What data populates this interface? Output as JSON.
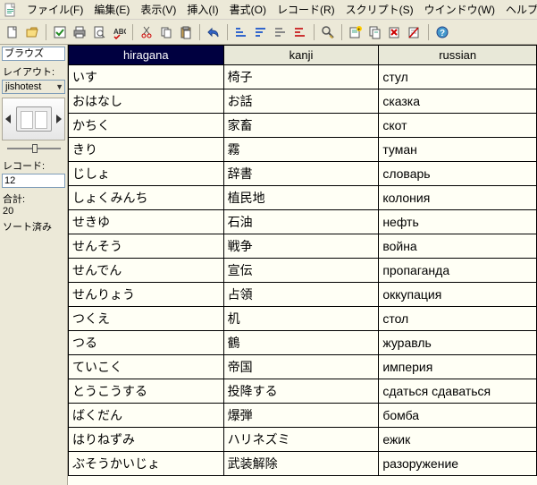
{
  "menu": {
    "file": "ファイル(F)",
    "edit": "編集(E)",
    "view": "表示(V)",
    "insert": "挿入(I)",
    "format": "書式(O)",
    "records": "レコード(R)",
    "scripts": "スクリプト(S)",
    "window": "ウインドウ(W)",
    "help": "ヘルプ(H)"
  },
  "sidebar": {
    "mode": "ブラウズ",
    "layout_label": "レイアウト:",
    "layout_value": "jishotest",
    "record_label": "レコード:",
    "record_value": "12",
    "total_label": "合計:",
    "total_value": "20",
    "sorted": "ソート済み"
  },
  "columns": {
    "c1": "hiragana",
    "c2": "kanji",
    "c3": "russian"
  },
  "rows": [
    {
      "h": "いす",
      "k": "椅子",
      "r": "стул"
    },
    {
      "h": "おはなし",
      "k": "お話",
      "r": "сказка"
    },
    {
      "h": "かちく",
      "k": "家畜",
      "r": "скот"
    },
    {
      "h": "きり",
      "k": "霧",
      "r": "туман"
    },
    {
      "h": "じしょ",
      "k": "辞書",
      "r": "словарь"
    },
    {
      "h": "しょくみんち",
      "k": "植民地",
      "r": "колония"
    },
    {
      "h": "せきゆ",
      "k": "石油",
      "r": "нефть"
    },
    {
      "h": "せんそう",
      "k": "戦争",
      "r": "война"
    },
    {
      "h": "せんでん",
      "k": "宣伝",
      "r": "пропаганда"
    },
    {
      "h": "せんりょう",
      "k": "占領",
      "r": "оккупация"
    },
    {
      "h": "つくえ",
      "k": "机",
      "r": "стол"
    },
    {
      "h": "つる",
      "k": "鶴",
      "r": "журавль"
    },
    {
      "h": "ていこく",
      "k": "帝国",
      "r": "империя"
    },
    {
      "h": "とうこうする",
      "k": "投降する",
      "r": "сдаться сдаваться"
    },
    {
      "h": "ばくだん",
      "k": "爆弾",
      "r": "бомба"
    },
    {
      "h": "はりねずみ",
      "k": "ハリネズミ",
      "r": "ежик"
    },
    {
      "h": "ぶそうかいじょ",
      "k": "武装解除",
      "r": "разоружение"
    }
  ],
  "icons": {
    "new": "new-doc",
    "open": "open",
    "checkbox": "check",
    "print": "print",
    "preview": "preview",
    "spell": "spell",
    "cut": "cut",
    "copy": "copy",
    "paste": "paste",
    "undo": "undo",
    "sort1": "sort",
    "sort2": "sort",
    "sort3": "sort",
    "sort4": "sort",
    "find": "find",
    "newrec": "newrec",
    "modrec": "modrec",
    "delrec": "delrec",
    "omit": "omit",
    "help": "help"
  }
}
